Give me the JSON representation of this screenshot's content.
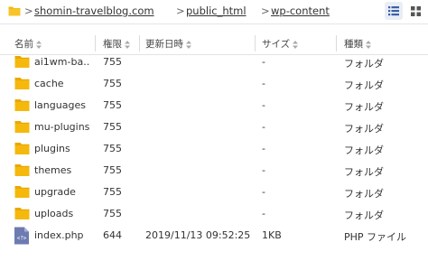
{
  "breadcrumb": {
    "items": [
      "shomin-travelblog.com",
      "public_html",
      "wp-content"
    ],
    "separator": ">"
  },
  "toolbar": {
    "list_view_icon": "list-view-icon",
    "grid_view_icon": "grid-view-icon"
  },
  "columns": {
    "name": "名前",
    "permission": "権限",
    "modified": "更新日時",
    "size": "サイズ",
    "type": "種類"
  },
  "rows": [
    {
      "name": "ai1wm-ba...",
      "permission": "755",
      "modified": "",
      "size": "-",
      "type": "フォルダ",
      "icon": "folder-icon"
    },
    {
      "name": "cache",
      "permission": "755",
      "modified": "",
      "size": "-",
      "type": "フォルダ",
      "icon": "folder-icon"
    },
    {
      "name": "languages",
      "permission": "755",
      "modified": "",
      "size": "-",
      "type": "フォルダ",
      "icon": "folder-icon"
    },
    {
      "name": "mu-plugins",
      "permission": "755",
      "modified": "",
      "size": "-",
      "type": "フォルダ",
      "icon": "folder-icon"
    },
    {
      "name": "plugins",
      "permission": "755",
      "modified": "",
      "size": "-",
      "type": "フォルダ",
      "icon": "folder-icon"
    },
    {
      "name": "themes",
      "permission": "755",
      "modified": "",
      "size": "-",
      "type": "フォルダ",
      "icon": "folder-icon"
    },
    {
      "name": "upgrade",
      "permission": "755",
      "modified": "",
      "size": "-",
      "type": "フォルダ",
      "icon": "folder-icon"
    },
    {
      "name": "uploads",
      "permission": "755",
      "modified": "",
      "size": "-",
      "type": "フォルダ",
      "icon": "folder-icon"
    },
    {
      "name": "index.php",
      "permission": "644",
      "modified": "2019/11/13 09:52:25",
      "size": "1KB",
      "type": "PHP ファイル",
      "icon": "php-file-icon"
    }
  ],
  "colors": {
    "folder": "#f5b80c",
    "folder_tab": "#e9a800",
    "php_icon": "#6c7bb0",
    "accent": "#3b5ea8"
  }
}
